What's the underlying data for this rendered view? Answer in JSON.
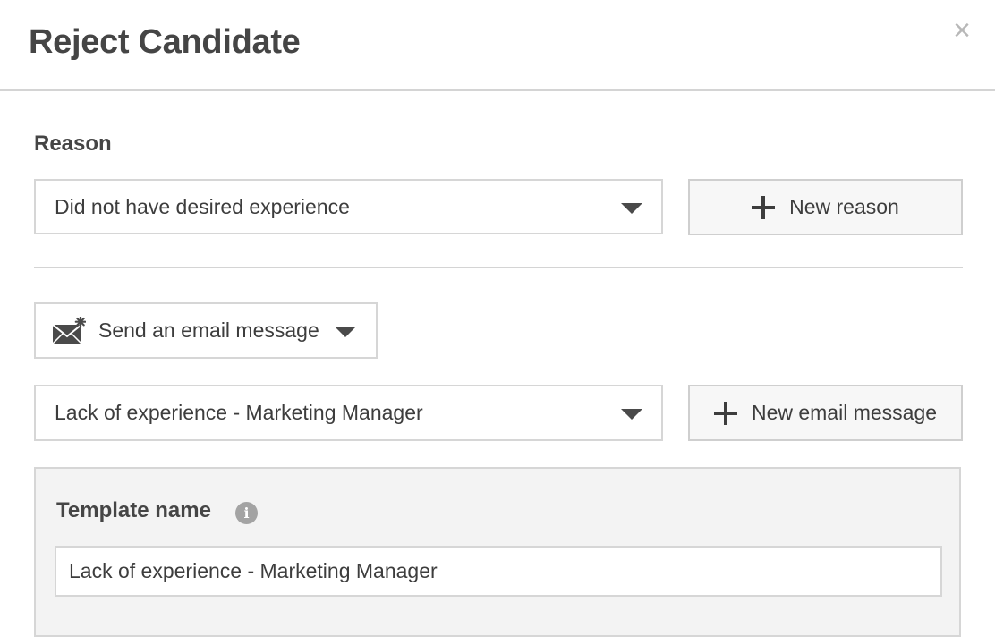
{
  "dialog": {
    "title": "Reject Candidate",
    "close_glyph": "×"
  },
  "reason": {
    "label": "Reason",
    "selected": "Did not have desired experience",
    "new_button_label": "New reason"
  },
  "email": {
    "action_label": "Send an email message",
    "template_selected": "Lack of experience - Marketing Manager",
    "new_button_label": "New email message"
  },
  "template": {
    "label": "Template name",
    "info_glyph": "i",
    "name_value": "Lack of experience - Marketing Manager"
  },
  "icons": {
    "close": "close-icon",
    "caret": "chevron-down-icon",
    "add": "plus-icon",
    "mail": "envelope-icon",
    "info": "info-icon"
  }
}
